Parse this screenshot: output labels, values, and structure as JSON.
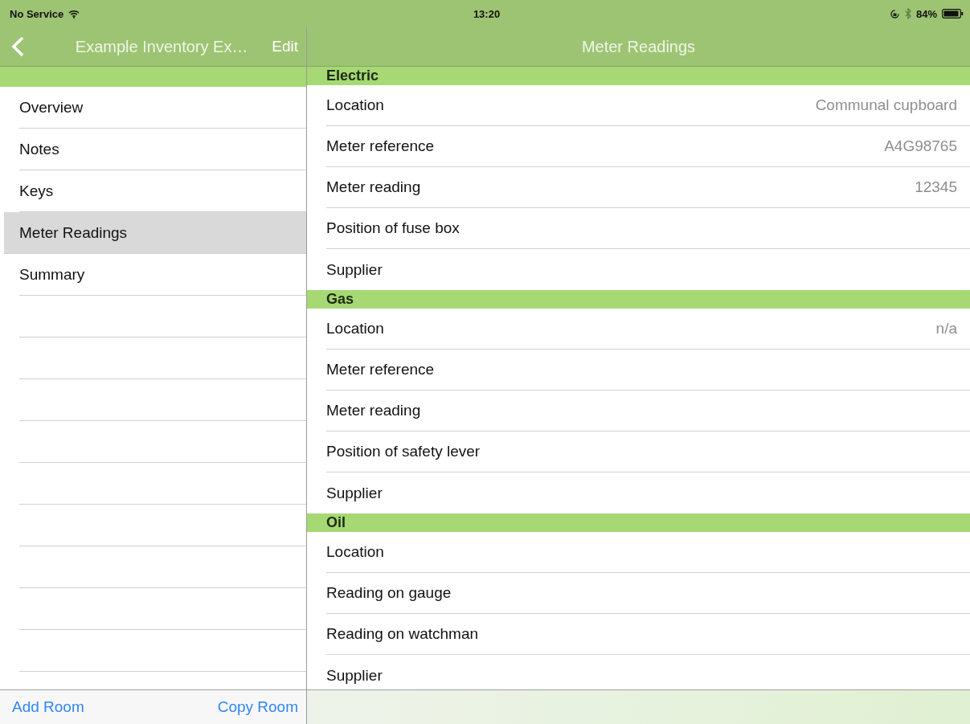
{
  "status_bar": {
    "carrier": "No Service",
    "time": "13:20",
    "battery": "84%"
  },
  "master": {
    "title": "Example Inventory Ex…",
    "edit": "Edit",
    "items": [
      {
        "label": "Overview",
        "selected": false
      },
      {
        "label": "Notes",
        "selected": false
      },
      {
        "label": "Keys",
        "selected": false
      },
      {
        "label": "Meter Readings",
        "selected": true
      },
      {
        "label": "Summary",
        "selected": false
      }
    ],
    "toolbar": [
      "Add Room",
      "Copy Room"
    ]
  },
  "detail": {
    "title": "Meter Readings",
    "sections": [
      {
        "title": "Electric",
        "rows": [
          {
            "label": "Location",
            "value": "Communal cupboard"
          },
          {
            "label": "Meter reference",
            "value": "A4G98765"
          },
          {
            "label": "Meter reading",
            "value": "12345"
          },
          {
            "label": "Position of fuse box"
          },
          {
            "label": "Supplier"
          }
        ]
      },
      {
        "title": "Gas",
        "rows": [
          {
            "label": "Location",
            "value": "n/a"
          },
          {
            "label": "Meter reference"
          },
          {
            "label": "Meter reading"
          },
          {
            "label": "Position of safety lever"
          },
          {
            "label": "Supplier"
          }
        ]
      },
      {
        "title": "Oil",
        "rows": [
          {
            "label": "Location"
          },
          {
            "label": "Reading on gauge"
          },
          {
            "label": "Reading on watchman"
          },
          {
            "label": "Supplier"
          }
        ]
      }
    ]
  }
}
